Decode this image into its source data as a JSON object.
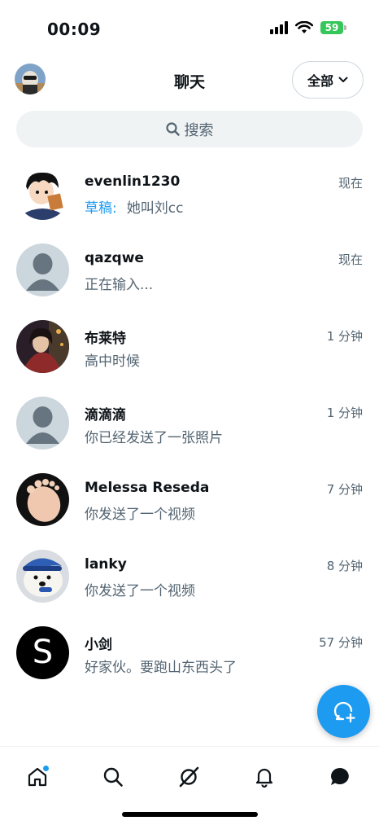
{
  "status_bar": {
    "time": "00:09",
    "battery": "59"
  },
  "header": {
    "title": "聊天",
    "filter_label": "全部"
  },
  "search": {
    "placeholder": "搜索"
  },
  "chats": [
    {
      "name": "evenlin1230",
      "time": "现在",
      "draft_label": "草稿:",
      "preview": "她叫刘cc",
      "avatar": "cartoon-boy"
    },
    {
      "name": "qazqwe",
      "time": "现在",
      "preview": "正在输入...",
      "avatar": "default"
    },
    {
      "name": "布莱特",
      "time": "1 分钟",
      "preview": "高中时候",
      "avatar": "anime"
    },
    {
      "name": "滴滴滴",
      "time": "1 分钟",
      "preview": "你已经发送了一张照片",
      "avatar": "default"
    },
    {
      "name": "Melessa Reseda",
      "time": "7 分钟",
      "preview": "你发送了一个视频",
      "avatar": "photo"
    },
    {
      "name": "lanky",
      "time": "8 分钟",
      "preview": "你发送了一个视频",
      "avatar": "dog"
    },
    {
      "name": "小剑",
      "time": "57 分钟",
      "preview": "好家伙。要跑山东西头了",
      "avatar": "letter-s"
    }
  ],
  "bottom_nav": [
    "home-icon",
    "search-icon",
    "grok-icon",
    "bell-icon",
    "messages-icon"
  ],
  "colors": {
    "accent": "#1d9bf0",
    "text": "#0f1419",
    "muted": "#536471",
    "battery": "#34c759"
  }
}
